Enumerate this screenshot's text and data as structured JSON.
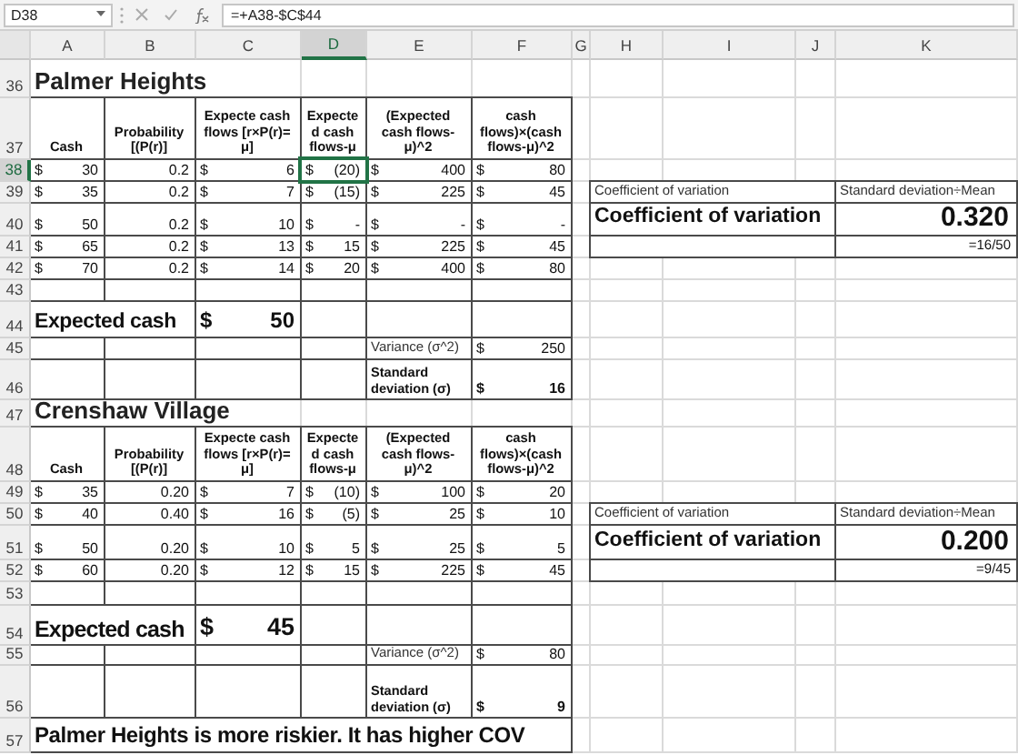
{
  "formula_bar": {
    "name_box": "D38",
    "formula": "=+A38-$C$44"
  },
  "columns": [
    {
      "label": "A",
      "selected": false
    },
    {
      "label": "B",
      "selected": false
    },
    {
      "label": "C",
      "selected": false
    },
    {
      "label": "D",
      "selected": true
    },
    {
      "label": "E",
      "selected": false
    },
    {
      "label": "F",
      "selected": false
    },
    {
      "label": "G",
      "selected": false
    },
    {
      "label": "H",
      "selected": false
    },
    {
      "label": "I",
      "selected": false
    },
    {
      "label": "J",
      "selected": false
    },
    {
      "label": "K",
      "selected": false
    }
  ],
  "rows": [
    {
      "number": "36",
      "selected": false
    },
    {
      "number": "37",
      "selected": false
    },
    {
      "number": "38",
      "selected": true
    },
    {
      "number": "39",
      "selected": false
    },
    {
      "number": "40",
      "selected": false
    },
    {
      "number": "41",
      "selected": false
    },
    {
      "number": "42",
      "selected": false
    },
    {
      "number": "43",
      "selected": false
    },
    {
      "number": "44",
      "selected": false
    },
    {
      "number": "45",
      "selected": false
    },
    {
      "number": "46",
      "selected": false
    },
    {
      "number": "47",
      "selected": false
    },
    {
      "number": "48",
      "selected": false
    },
    {
      "number": "49",
      "selected": false
    },
    {
      "number": "50",
      "selected": false
    },
    {
      "number": "51",
      "selected": false
    },
    {
      "number": "52",
      "selected": false
    },
    {
      "number": "53",
      "selected": false
    },
    {
      "number": "54",
      "selected": false
    },
    {
      "number": "55",
      "selected": false
    },
    {
      "number": "56",
      "selected": false
    },
    {
      "number": "57",
      "selected": false
    }
  ],
  "sections": [
    {
      "title": "Palmer Heights",
      "headers": [
        "Cash",
        "Probability [(P(r)]",
        "Expecte cash flows [r×P(r)= μ]",
        "Expecte d cash flows-μ",
        "(Expected cash flows-μ)^2",
        "cash flows)×(cash flows-μ)^2"
      ],
      "data": [
        [
          {
            "currency": "$",
            "amount": "30",
            "selected": false
          },
          {
            "amount": "0.2",
            "selected": false
          },
          {
            "currency": "$",
            "amount": "6",
            "selected": false
          },
          {
            "currency": "$",
            "amount": "(20)",
            "selected": true
          },
          {
            "currency": "$",
            "amount": "400",
            "selected": false
          },
          {
            "currency": "$",
            "amount": "80",
            "selected": false
          }
        ],
        [
          {
            "currency": "$",
            "amount": "35",
            "selected": false
          },
          {
            "amount": "0.2",
            "selected": false
          },
          {
            "currency": "$",
            "amount": "7",
            "selected": false
          },
          {
            "currency": "$",
            "amount": "(15)",
            "selected": false
          },
          {
            "currency": "$",
            "amount": "225",
            "selected": false
          },
          {
            "currency": "$",
            "amount": "45",
            "selected": false
          }
        ],
        [
          {
            "currency": "$",
            "amount": "50",
            "selected": false
          },
          {
            "amount": "0.2",
            "selected": false
          },
          {
            "currency": "$",
            "amount": "10",
            "selected": false
          },
          {
            "currency": "$",
            "amount": "-",
            "selected": false
          },
          {
            "currency": "$",
            "amount": "-",
            "selected": false
          },
          {
            "currency": "$",
            "amount": "-",
            "selected": false
          }
        ],
        [
          {
            "currency": "$",
            "amount": "65",
            "selected": false
          },
          {
            "amount": "0.2",
            "selected": false
          },
          {
            "currency": "$",
            "amount": "13",
            "selected": false
          },
          {
            "currency": "$",
            "amount": "15",
            "selected": false
          },
          {
            "currency": "$",
            "amount": "225",
            "selected": false
          },
          {
            "currency": "$",
            "amount": "45",
            "selected": false
          }
        ],
        [
          {
            "currency": "$",
            "amount": "70",
            "selected": false
          },
          {
            "amount": "0.2",
            "selected": false
          },
          {
            "currency": "$",
            "amount": "14",
            "selected": false
          },
          {
            "currency": "$",
            "amount": "20",
            "selected": false
          },
          {
            "currency": "$",
            "amount": "400",
            "selected": false
          },
          {
            "currency": "$",
            "amount": "80",
            "selected": false
          }
        ]
      ],
      "expected_cash": {
        "label": "Expected cash",
        "currency": "$",
        "amount": "50"
      },
      "variance": {
        "label": "Variance (σ^2)",
        "currency": "$",
        "amount": "250"
      },
      "std_dev": {
        "label": "Standard deviation (σ)",
        "currency": "$",
        "amount": "16"
      },
      "cov": {
        "label": "Coefficient of variation",
        "formula_label": "Standard deviation÷Mean",
        "title": "Coefficient of variation",
        "value": "0.320",
        "note": "=16/50"
      }
    },
    {
      "title": "Crenshaw Village",
      "headers": [
        "Cash",
        "Probability [(P(r)]",
        "Expecte cash flows [r×P(r)= μ]",
        "Expecte d cash flows-μ",
        "(Expected cash flows-μ)^2",
        "cash flows)×(cash flows-μ)^2"
      ],
      "data": [
        [
          {
            "currency": "$",
            "amount": "35",
            "selected": false
          },
          {
            "amount": "0.20",
            "selected": false
          },
          {
            "currency": "$",
            "amount": "7",
            "selected": false
          },
          {
            "currency": "$",
            "amount": "(10)",
            "selected": false
          },
          {
            "currency": "$",
            "amount": "100",
            "selected": false
          },
          {
            "currency": "$",
            "amount": "20",
            "selected": false
          }
        ],
        [
          {
            "currency": "$",
            "amount": "40",
            "selected": false
          },
          {
            "amount": "0.40",
            "selected": false
          },
          {
            "currency": "$",
            "amount": "16",
            "selected": false
          },
          {
            "currency": "$",
            "amount": "(5)",
            "selected": false
          },
          {
            "currency": "$",
            "amount": "25",
            "selected": false
          },
          {
            "currency": "$",
            "amount": "10",
            "selected": false
          }
        ],
        [
          {
            "currency": "$",
            "amount": "50",
            "selected": false
          },
          {
            "amount": "0.20",
            "selected": false
          },
          {
            "currency": "$",
            "amount": "10",
            "selected": false
          },
          {
            "currency": "$",
            "amount": "5",
            "selected": false
          },
          {
            "currency": "$",
            "amount": "25",
            "selected": false
          },
          {
            "currency": "$",
            "amount": "5",
            "selected": false
          }
        ],
        [
          {
            "currency": "$",
            "amount": "60",
            "selected": false
          },
          {
            "amount": "0.20",
            "selected": false
          },
          {
            "currency": "$",
            "amount": "12",
            "selected": false
          },
          {
            "currency": "$",
            "amount": "15",
            "selected": false
          },
          {
            "currency": "$",
            "amount": "225",
            "selected": false
          },
          {
            "currency": "$",
            "amount": "45",
            "selected": false
          }
        ]
      ],
      "expected_cash": {
        "label": "Expected cash",
        "currency": "$",
        "amount": "45"
      },
      "variance": {
        "label": "Variance (σ^2)",
        "currency": "$",
        "amount": "80"
      },
      "std_dev": {
        "label": "Standard deviation (σ)",
        "currency": "$",
        "amount": "9"
      },
      "cov": {
        "label": "Coefficient of variation",
        "formula_label": "Standard deviation÷Mean",
        "title": "Coefficient of variation",
        "value": "0.200",
        "note": "=9/45"
      }
    }
  ],
  "conclusion": "Palmer Heights is more riskier. It has higher COV"
}
